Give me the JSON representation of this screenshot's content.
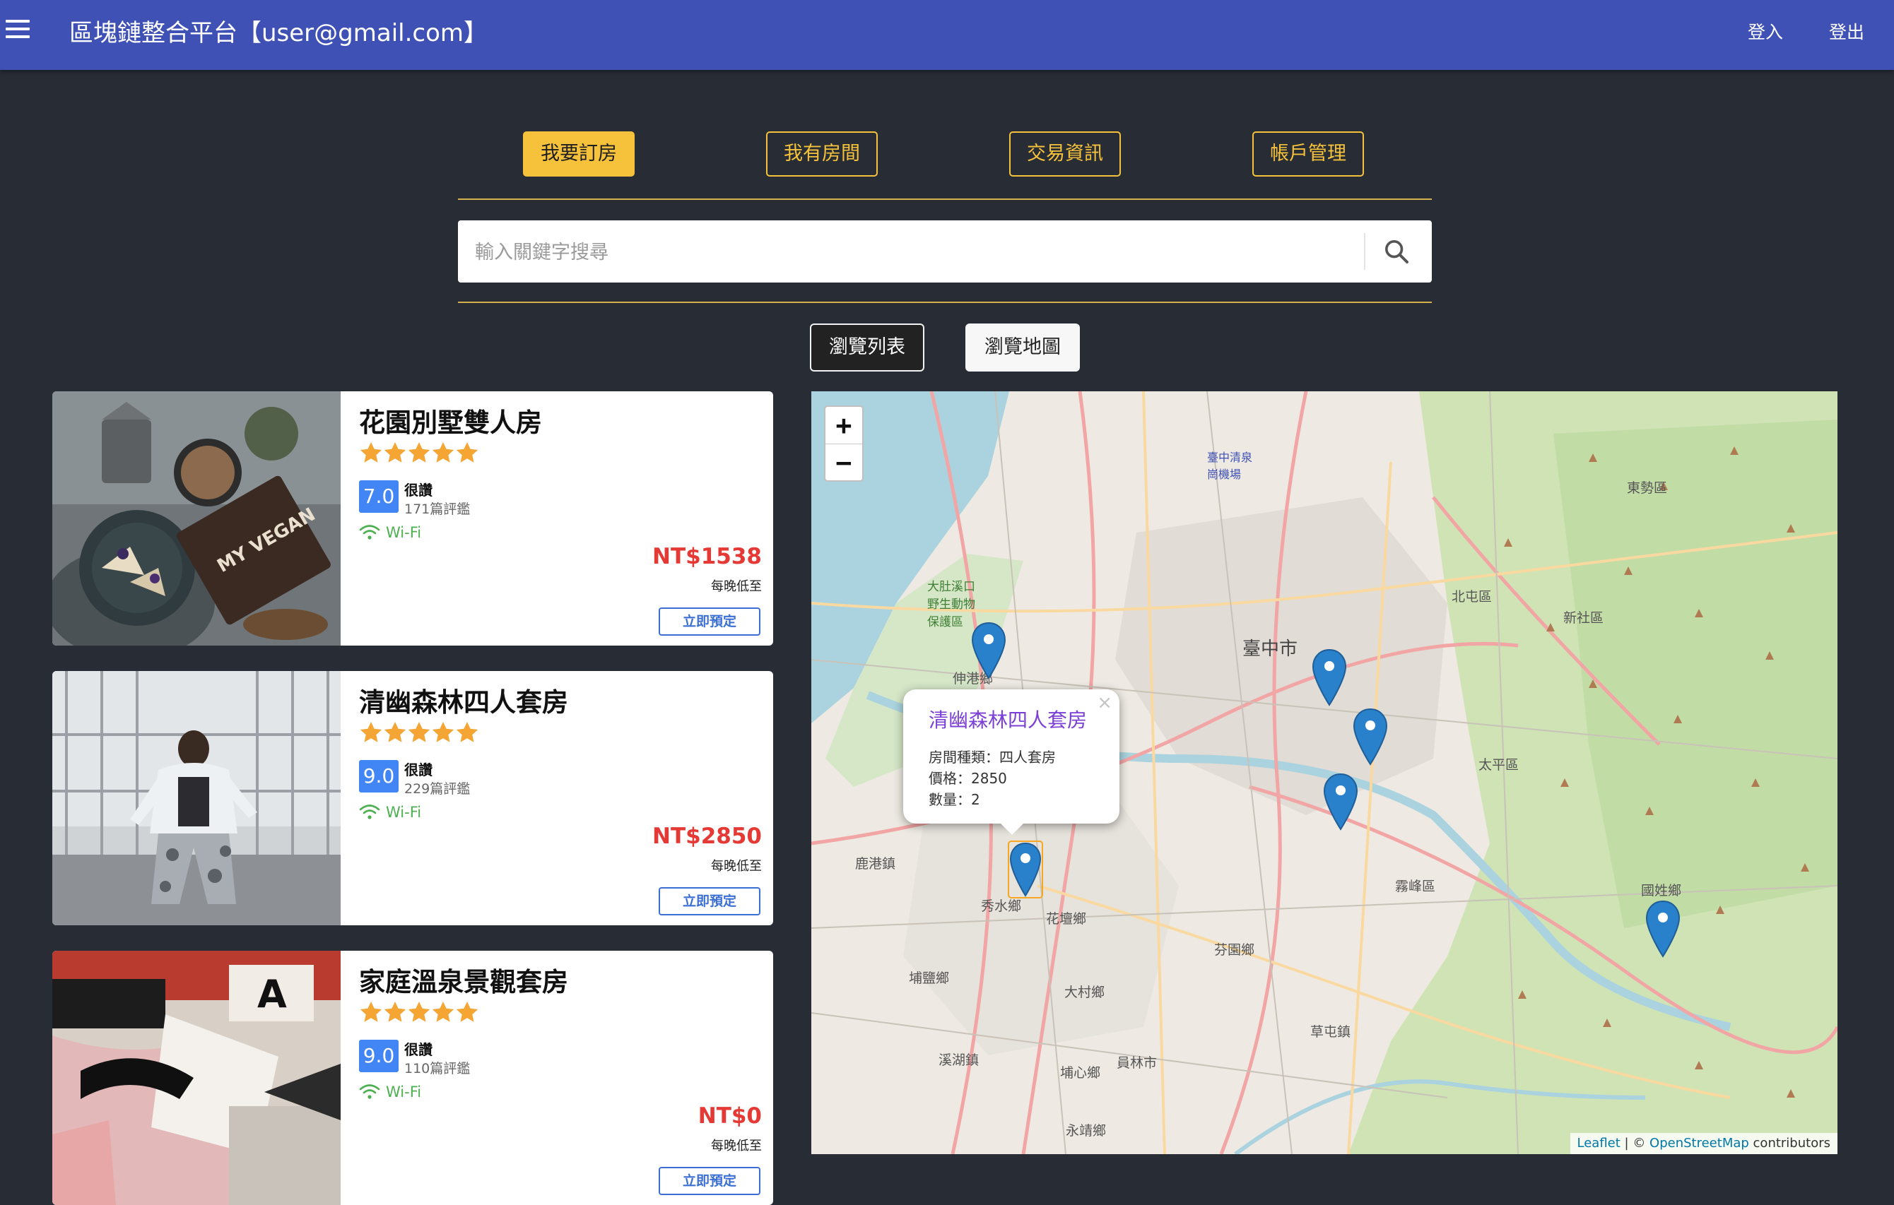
{
  "header": {
    "title": "區塊鏈整合平台【user@gmail.com】",
    "login": "登入",
    "logout": "登出"
  },
  "nav": {
    "tabs": [
      "我要訂房",
      "我有房間",
      "交易資訊",
      "帳戶管理"
    ],
    "active_index": 0
  },
  "search": {
    "placeholder": "輸入關鍵字搜尋"
  },
  "view_toggle": {
    "list": "瀏覽列表",
    "map": "瀏覽地圖"
  },
  "listings": [
    {
      "title": "花園別墅雙人房",
      "stars": 5,
      "score": "7.0",
      "score_label": "很讚",
      "reviews": "171篇評鑑",
      "amenity": "Wi-Fi",
      "price": "NT$1538",
      "price_note": "每晚低至",
      "book": "立即預定"
    },
    {
      "title": "清幽森林四人套房",
      "stars": 5,
      "score": "9.0",
      "score_label": "很讚",
      "reviews": "229篇評鑑",
      "amenity": "Wi-Fi",
      "price": "NT$2850",
      "price_note": "每晚低至",
      "book": "立即預定"
    },
    {
      "title": "家庭溫泉景觀套房",
      "stars": 5,
      "score": "9.0",
      "score_label": "很讚",
      "reviews": "110篇評鑑",
      "amenity": "Wi-Fi",
      "price": "NT$0",
      "price_note": "每晚低至",
      "book": "立即預定"
    }
  ],
  "map": {
    "zoom_in": "+",
    "zoom_out": "−",
    "popup": {
      "title": "清幽森林四人套房",
      "type_line": "房間種類：四人套房",
      "price_line": "價格：2850",
      "qty_line": "數量：2",
      "close": "×"
    },
    "attribution": {
      "leaflet": "Leaflet",
      "sep": " | © ",
      "osm": "OpenStreetMap",
      "suffix": " contributors"
    },
    "labels": {
      "taichung": "臺中市",
      "dongshi": "東勢區",
      "beitun": "北屯區",
      "xinshe": "新社區",
      "taiping": "太平區",
      "wufeng": "霧峰區",
      "guoxing": "國姓鄉",
      "lugang": "鹿港鎮",
      "xiushui": "秀水鄉",
      "huatan": "花壇鄉",
      "fenyuan": "芬園鄉",
      "puyan": "埔鹽鄉",
      "dacun": "大村鄉",
      "caotun": "草屯鎮",
      "xihu": "溪湖鎮",
      "puxin": "埔心鄉",
      "yuanlin": "員林市",
      "yongjing": "永靖鄉",
      "shengang": "伸港鄉",
      "airport": "臺中清泉崗機場",
      "dadu": "大肚溪口野生動物保護區"
    }
  },
  "colors": {
    "appbar": "#3f51b5",
    "accent": "#f6c23b",
    "background": "#282c34",
    "price": "#e53935",
    "score_badge": "#4285f4",
    "popup_title": "#7b3fd6",
    "marker": "#2a81cb"
  }
}
